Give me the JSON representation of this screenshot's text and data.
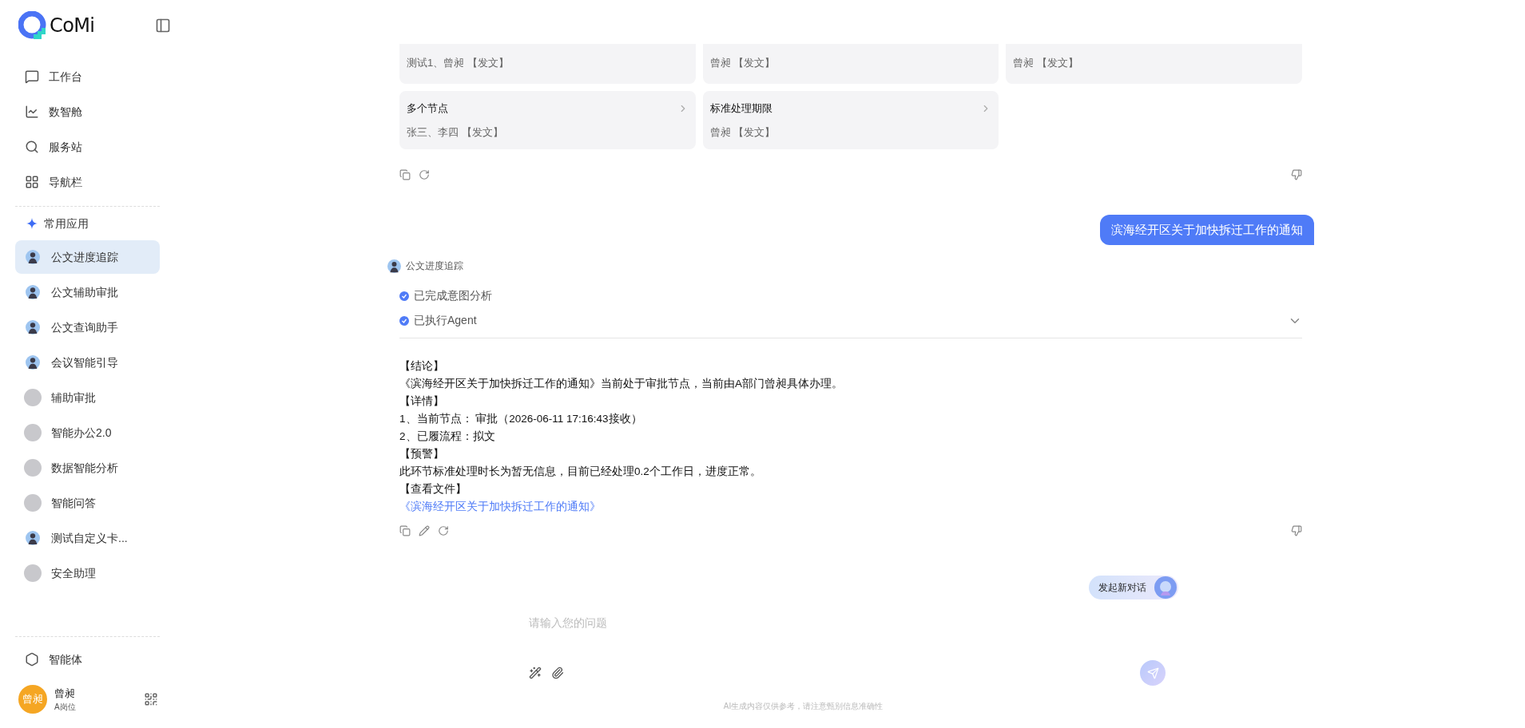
{
  "sidebar": {
    "logo": "CoMi",
    "nav": [
      {
        "label": "工作台",
        "selected": false
      },
      {
        "label": "数智舱",
        "selected": false
      },
      {
        "label": "服务站",
        "selected": false
      },
      {
        "label": "导航栏",
        "selected": false
      }
    ],
    "section_title": "常用应用",
    "apps": [
      {
        "label": "公文进度追踪",
        "kind": "figure",
        "selected": true
      },
      {
        "label": "公文辅助审批",
        "kind": "figure",
        "selected": false
      },
      {
        "label": "公文查询助手",
        "kind": "figure",
        "selected": false
      },
      {
        "label": "会议智能引导",
        "kind": "figure",
        "selected": false
      },
      {
        "label": "辅助审批",
        "kind": "blank",
        "selected": false
      },
      {
        "label": "智能办公2.0",
        "kind": "blank",
        "selected": false
      },
      {
        "label": "数据智能分析",
        "kind": "blank",
        "selected": false
      },
      {
        "label": "智能问答",
        "kind": "blank",
        "selected": false
      },
      {
        "label": "测试自定义卡...",
        "kind": "figure",
        "selected": false
      },
      {
        "label": "安全助理",
        "kind": "blank",
        "selected": false
      }
    ],
    "agents": "智能体",
    "user": {
      "avatar_text": "曾昶",
      "name": "曾昶",
      "role": "A岗位"
    }
  },
  "chat": {
    "cut_cards": [
      "测试1、曾昶 【发文】",
      "曾昶 【发文】",
      "曾昶 【发文】"
    ],
    "cards": [
      {
        "title": "多个节点",
        "subtitle": "张三、李四 【发文】"
      },
      {
        "title": "标准处理期限",
        "subtitle": "曾昶 【发文】"
      }
    ],
    "user_message": "滨海经开区关于加快拆迁工作的通知",
    "bot_name": "公文进度追踪",
    "steps": [
      {
        "label": "已完成意图分析",
        "done": true
      },
      {
        "label": "已执行Agent",
        "done": true
      }
    ],
    "answer": [
      {
        "kind": "text",
        "text": "【结论】"
      },
      {
        "kind": "text",
        "text": "《滨海经开区关于加快拆迁工作的通知》当前处于审批节点，当前由A部门曾昶具体办理。"
      },
      {
        "kind": "text",
        "text": "【详情】"
      },
      {
        "kind": "text",
        "text": "1、当前节点： 审批（2026-06-11 17:16:43接收）"
      },
      {
        "kind": "text",
        "text": "2、已履流程：拟文"
      },
      {
        "kind": "text",
        "text": "【预警】"
      },
      {
        "kind": "text",
        "text": "此环节标准处理时长为暂无信息，目前已经处理0.2个工作日，进度正常。"
      },
      {
        "kind": "text",
        "text": "【查看文件】"
      },
      {
        "kind": "link",
        "text": "《滨海经开区关于加快拆迁工作的通知》"
      }
    ]
  },
  "new_chat": "发起新对话",
  "input": {
    "placeholder": "请输入您的问题"
  },
  "footer": "AI生成内容仅供参考，请注意甄别信息准确性"
}
